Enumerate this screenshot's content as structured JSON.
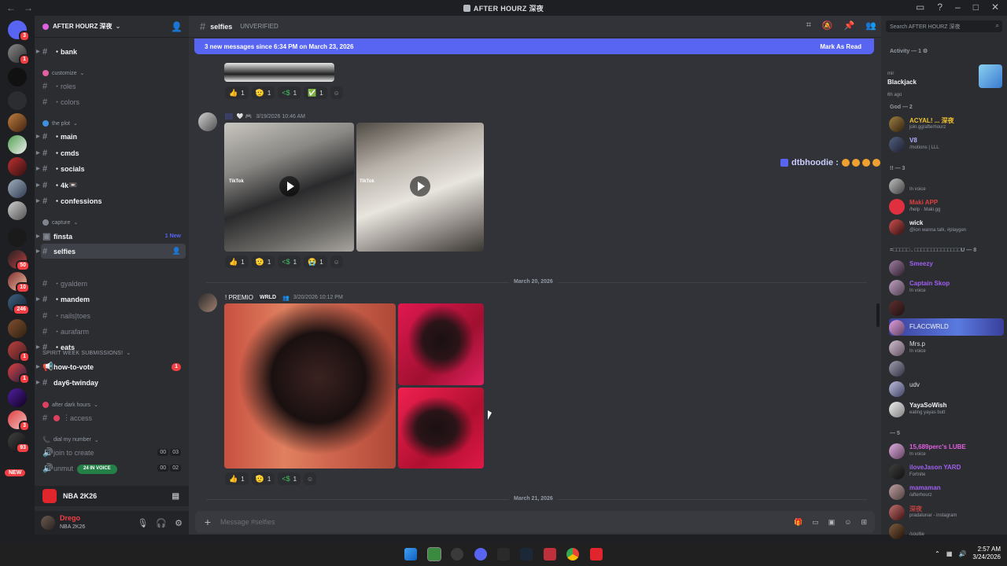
{
  "window": {
    "title": "AFTER HOURZ 深夜"
  },
  "server": {
    "name": "AFTER HOURZ 深夜",
    "sections": [
      {
        "type": "channel",
        "name": "bank",
        "bold": true
      },
      {
        "type": "category",
        "name": "customize"
      },
      {
        "type": "channel",
        "name": "roles"
      },
      {
        "type": "channel",
        "name": "colors"
      },
      {
        "type": "category",
        "name": "the plot"
      },
      {
        "type": "channel",
        "name": "main",
        "bold": true
      },
      {
        "type": "channel",
        "name": "cmds",
        "bold": true
      },
      {
        "type": "channel",
        "name": "socials",
        "bold": true
      },
      {
        "type": "channel",
        "name": "4k",
        "bold": true
      },
      {
        "type": "channel",
        "name": "confessions",
        "bold": true
      },
      {
        "type": "category",
        "name": "capture"
      },
      {
        "type": "channel",
        "name": "finsta",
        "bold": true,
        "badge": "1 New"
      },
      {
        "type": "channel",
        "name": "selfies",
        "selected": true
      },
      {
        "type": "channel",
        "name": "gyaldem"
      },
      {
        "type": "channel",
        "name": "mandem",
        "bold": true
      },
      {
        "type": "channel",
        "name": "nails|toes"
      },
      {
        "type": "channel",
        "name": "aurafarm"
      },
      {
        "type": "channel",
        "name": "eats",
        "bold": true
      },
      {
        "type": "category",
        "name": "SPIRIT WEEK SUBMISSIONS!"
      },
      {
        "type": "channel",
        "name": "how-to-vote",
        "bold": true,
        "count": "1"
      },
      {
        "type": "channel",
        "name": "day6-twinday",
        "bold": true
      },
      {
        "type": "category",
        "name": "after dark hours"
      },
      {
        "type": "channel",
        "name": "access"
      },
      {
        "type": "category",
        "name": "dial my number"
      },
      {
        "type": "voice",
        "name": "join to create",
        "counts": [
          "00",
          "03"
        ]
      },
      {
        "type": "voice",
        "name": "unmut",
        "counts": [
          "00",
          "02"
        ]
      }
    ],
    "voice_pill": "24 IN VOICE",
    "new_pill": "NEW"
  },
  "game": {
    "name": "NBA 2K26"
  },
  "user": {
    "name": "Drego",
    "status": "NBA 2K26"
  },
  "channel": {
    "name": "selfies",
    "topic": "UNVERIFIED",
    "new_banner": "3 new messages since 6:34 PM on March 23, 2026",
    "mark_read": "Mark As Read",
    "composer_placeholder": "Message #selfies"
  },
  "messages": [
    {
      "reactions": [
        [
          "👍",
          "1"
        ],
        [
          "🫡",
          "1"
        ],
        [
          "<$",
          "1"
        ],
        [
          "✅",
          "1"
        ]
      ]
    },
    {
      "timestamp": "3/19/2026 10:46 AM",
      "tiktok": "TikTok",
      "reactions": [
        [
          "👍",
          "1"
        ],
        [
          "🫡",
          "1"
        ],
        [
          "<$",
          "1"
        ],
        [
          "😭",
          "1"
        ]
      ]
    },
    {
      "date": "March 20, 2026"
    },
    {
      "username": "! PREMIO",
      "tag": "WRLD",
      "timestamp": "3/20/2026 10:12 PM",
      "reactions": [
        [
          "👍",
          "1"
        ],
        [
          "🫡",
          "1"
        ],
        [
          "<$",
          "1"
        ]
      ]
    },
    {
      "date": "March 21, 2026"
    }
  ],
  "typing": {
    "name": "dtbhoodie :"
  },
  "members": {
    "search_placeholder": "Search AFTER HOURZ 深夜",
    "activity_header": "Activity — 1",
    "activity": {
      "small": "mir",
      "title": "Blackjack",
      "time": "6h ago"
    },
    "groups": [
      {
        "label": "God — 2",
        "items": [
          {
            "name": "ACYAL! ... 深夜",
            "status": "join.gg/afterhourz",
            "color": "#f0c030"
          },
          {
            "name": "V8",
            "status": "/motions | LLL",
            "color": "#b0b0ff"
          }
        ]
      },
      {
        "label": "!! — 3",
        "items": [
          {
            "name": "",
            "status": "In voice",
            "color": "#e060e0"
          },
          {
            "name": "Maki APP",
            "status": "/help · Maki.gg",
            "color": "#e04040"
          },
          {
            "name": "wick",
            "status": "@ion wanna talk, #playgen",
            "color": "#f2f3f5"
          }
        ]
      },
      {
        "label": "=□□□□□ . □□□□□□□□□□□□□□U — 8",
        "items": [
          {
            "name": "Smeezy",
            "status": "",
            "color": "#a060f0"
          },
          {
            "name": "Captain Skop",
            "status": "In voice",
            "color": "#a060f0"
          },
          {
            "name": "",
            "status": "",
            "color": "#c04040"
          },
          {
            "name": "FLACCWRLD",
            "status": "",
            "color": "#f2f3f5"
          },
          {
            "name": "Mrs.p",
            "status": "In voice",
            "color": "#dbdee1"
          },
          {
            "name": "",
            "status": "",
            "color": "#a060f0"
          },
          {
            "name": "udv",
            "status": "",
            "color": "#dbdee1"
          },
          {
            "name": "YayaSoWish",
            "status": "eating yayas butt",
            "color": "#f2f3f5"
          }
        ]
      },
      {
        "label": "— 5",
        "items": [
          {
            "name": "15,689perc's LUBE",
            "status": "In voice",
            "color": "#e060e0"
          },
          {
            "name": "iloveJason YARD",
            "status": "Fortnite",
            "color": "#a060f0"
          },
          {
            "name": "mamaman",
            "status": "/afterhourz",
            "color": "#a060f0"
          },
          {
            "name": "深夜",
            "status": "pradalunar - instagram",
            "color": "#c04040"
          },
          {
            "name": "",
            "status": "/soultie",
            "color": "#c04040"
          }
        ]
      }
    ]
  },
  "taskbar": {
    "time": "2:57 AM",
    "date": "3/24/2026"
  }
}
